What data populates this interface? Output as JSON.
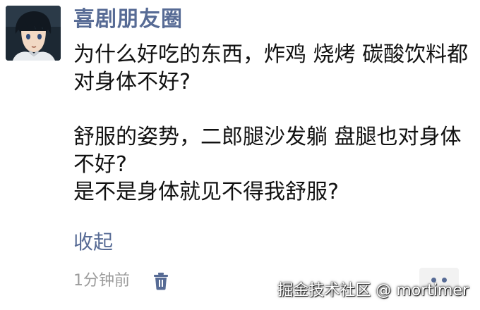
{
  "post": {
    "username": "喜剧朋友圈",
    "paragraphs": [
      "为什么好吃的东西，炸鸡 烧烤 碳酸饮料都对身体不好?",
      "",
      "舒服的姿势，二郎腿沙发躺 盘腿也对身体不好?",
      "是不是身体就见不得我舒服?"
    ],
    "collapse_label": "收起",
    "time": "1分钟前",
    "delete_icon": "trash-icon",
    "more_icon": "more-dots-icon"
  },
  "watermark": "掘金技术社区 @ mortimer",
  "colors": {
    "link_blue": "#576b95",
    "text": "#111111",
    "meta_gray": "#9b9b9b",
    "more_bg": "#f2f2f2"
  }
}
